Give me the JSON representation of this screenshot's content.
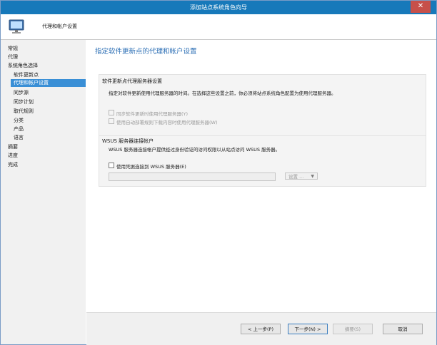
{
  "window": {
    "title": "添加站点系统角色向导",
    "close_symbol": "✕"
  },
  "header": {
    "title": "代理和帐户设置",
    "icon": "computer-monitor-icon"
  },
  "sidebar": {
    "items": [
      {
        "label": "常规"
      },
      {
        "label": "代理"
      },
      {
        "label": "系统角色选择"
      },
      {
        "label": "软件更新点"
      },
      {
        "label": "代理和帐户设置",
        "active": true
      },
      {
        "label": "同步源"
      },
      {
        "label": "同步计划"
      },
      {
        "label": "取代规则"
      },
      {
        "label": "分类"
      },
      {
        "label": "产品"
      },
      {
        "label": "语言"
      },
      {
        "label": "摘要"
      },
      {
        "label": "进度"
      },
      {
        "label": "完成"
      }
    ]
  },
  "main": {
    "title": "指定软件更新点的代理和帐户设置",
    "proxy_group": {
      "title": "软件更新点代理服务器设置",
      "description": "指定对软件更新使用代理服务器的时间。在选择这些设置之前，你必须将站点系统角色配置为使用代理服务器。",
      "checkbox1_label": "同步软件更新时使用代理服务器(Y)",
      "checkbox2_label": "使用自动部署规则下载内容时使用代理服务器(W)"
    },
    "wsus_group": {
      "title": "WSUS 服务器连接帐户",
      "description": "WSUS 服务器连接帐户提供经过身份验证的访问权限以从站点访问 WSUS 服务器。",
      "checkbox_label": "使用凭据连接到 WSUS 服务器(E)",
      "account_value": "",
      "settings_label": "设置 ...",
      "settings_chevron": "▼"
    }
  },
  "footer": {
    "prev_label": "< 上一步(P)",
    "next_label": "下一步(N) >",
    "summary_label": "摘要(S)",
    "cancel_label": "取消"
  },
  "colors": {
    "titlebar": "#1779ba",
    "accent": "#2c6fb5",
    "active_nav": "#3a8fd6"
  }
}
